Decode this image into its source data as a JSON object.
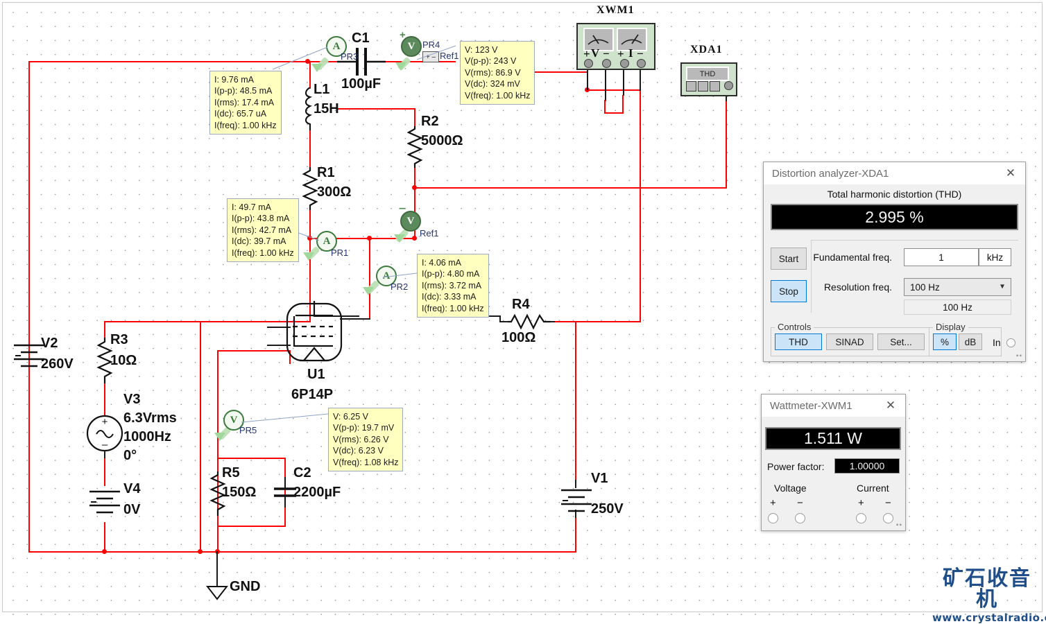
{
  "schematic": {
    "components": [
      {
        "ref": "V2",
        "value": "260V",
        "type": "dc-source"
      },
      {
        "ref": "R3",
        "value": "10Ω",
        "type": "resistor"
      },
      {
        "ref": "V3",
        "value": "6.3Vrms",
        "value2": "1000Hz",
        "value3": "0°",
        "type": "ac-source"
      },
      {
        "ref": "V4",
        "value": "0V",
        "type": "dc-source"
      },
      {
        "ref": "R5",
        "value": "150Ω",
        "type": "resistor"
      },
      {
        "ref": "C2",
        "value": "2200µF",
        "type": "capacitor"
      },
      {
        "ref": "L1",
        "value": "15H",
        "type": "inductor"
      },
      {
        "ref": "R1",
        "value": "300Ω",
        "type": "resistor"
      },
      {
        "ref": "C1",
        "value": "100µF",
        "type": "capacitor"
      },
      {
        "ref": "R2",
        "value": "5000Ω",
        "type": "resistor"
      },
      {
        "ref": "R4",
        "value": "100Ω",
        "type": "resistor"
      },
      {
        "ref": "V1",
        "value": "250V",
        "type": "dc-source"
      },
      {
        "ref": "U1",
        "value": "6P14P",
        "type": "vacuum-tube"
      },
      {
        "ref": "GND",
        "value": "GND",
        "type": "ground"
      }
    ],
    "instrument_labels": {
      "wattmeter": "XWM1",
      "distortion_analyzer": "XDA1",
      "wattmeter_pins": [
        "+",
        "V",
        "−",
        "+",
        "I",
        "−"
      ],
      "analyzer_screen": "THD"
    },
    "probes": [
      {
        "name": "PR3",
        "kind": "current"
      },
      {
        "name": "PR4",
        "kind": "voltage"
      },
      {
        "name": "PR1",
        "kind": "current"
      },
      {
        "name": "PR2",
        "kind": "current"
      },
      {
        "name": "PR5",
        "kind": "voltage"
      },
      {
        "name": "Ref1",
        "kind": "reference"
      }
    ],
    "reference_tag": "Ref1"
  },
  "tooltips": {
    "pr3": {
      "lines": [
        "I: 9.76 mA",
        "I(p-p): 48.5 mA",
        "I(rms): 17.4 mA",
        "I(dc): 65.7 uA",
        "I(freq): 1.00 kHz"
      ]
    },
    "pr4": {
      "lines": [
        "V: 123 V",
        "V(p-p): 243 V",
        "V(rms): 86.9 V",
        "V(dc): 324 mV",
        "V(freq): 1.00 kHz"
      ]
    },
    "pr1": {
      "lines": [
        "I: 49.7 mA",
        "I(p-p): 43.8 mA",
        "I(rms): 42.7 mA",
        "I(dc): 39.7 mA",
        "I(freq): 1.00 kHz"
      ]
    },
    "pr2": {
      "lines": [
        "I: 4.06 mA",
        "I(p-p): 4.80 mA",
        "I(rms): 3.72 mA",
        "I(dc): 3.33 mA",
        "I(freq): 1.00 kHz"
      ]
    },
    "pr5": {
      "lines": [
        "V: 6.25 V",
        "V(p-p): 19.7 mV",
        "V(rms): 6.26 V",
        "V(dc): 6.23 V",
        "V(freq): 1.08 kHz"
      ]
    }
  },
  "distortion_window": {
    "title": "Distortion analyzer-XDA1",
    "close": "✕",
    "caption": "Total harmonic distortion (THD)",
    "reading": "2.995 %",
    "start_label": "Start",
    "stop_label": "Stop",
    "fundamental_label": "Fundamental freq.",
    "fundamental_value": "1",
    "fundamental_unit": "kHz",
    "resolution_label": "Resolution freq.",
    "resolution_value": "100 Hz",
    "resolution_readout": "100 Hz",
    "controls_label": "Controls",
    "thd_label": "THD",
    "sinad_label": "SINAD",
    "set_label": "Set...",
    "display_label": "Display",
    "percent_label": "%",
    "db_label": "dB",
    "in_label": "In"
  },
  "wattmeter_window": {
    "title": "Wattmeter-XWM1",
    "close": "✕",
    "reading": "1.511 W",
    "power_factor_label": "Power factor:",
    "power_factor_value": "1.00000",
    "voltage_label": "Voltage",
    "current_label": "Current",
    "plus": "+",
    "minus": "−"
  },
  "watermark": {
    "chinese": "矿石收音机",
    "url": "www.crystalradio.cn"
  }
}
